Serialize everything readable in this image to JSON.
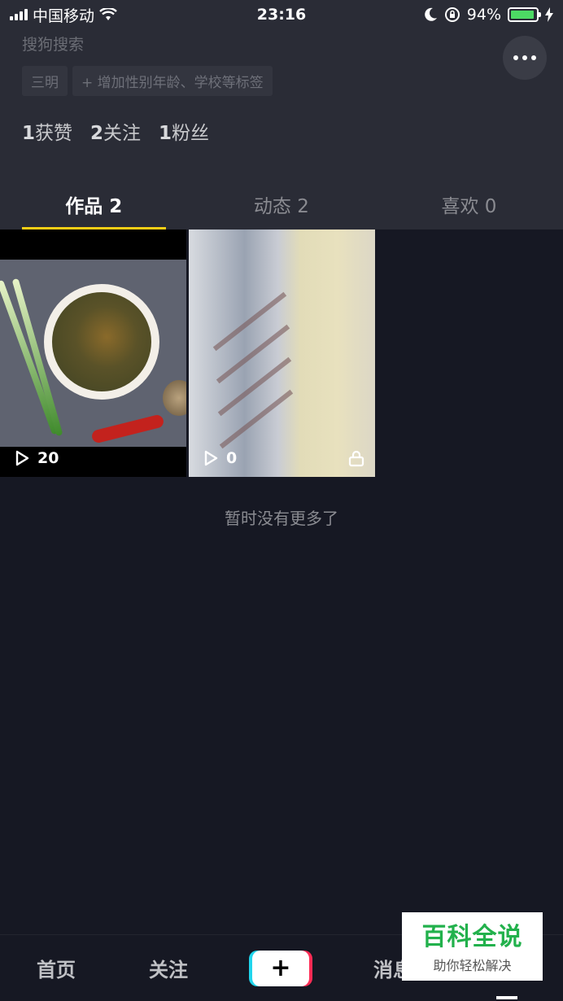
{
  "status_bar": {
    "carrier": "中国移动",
    "time": "23:16",
    "battery": "94%",
    "battery_level": 0.94
  },
  "profile": {
    "search_hint": "搜狗搜索",
    "tags": [
      "三明",
      "+ 增加性别年龄、学校等标签"
    ],
    "stats": [
      {
        "value": "1",
        "label": "获赞"
      },
      {
        "value": "2",
        "label": "关注"
      },
      {
        "value": "1",
        "label": "粉丝"
      }
    ]
  },
  "tabs": [
    {
      "label": "作品 2",
      "active": true
    },
    {
      "label": "动态 2",
      "active": false
    },
    {
      "label": "喜欢 0",
      "active": false
    }
  ],
  "videos": [
    {
      "plays": "20",
      "locked": false,
      "icon": "play-icon"
    },
    {
      "plays": "0",
      "locked": true,
      "icon": "play-icon"
    }
  ],
  "empty_hint": "暂时没有更多了",
  "bottom_nav": {
    "home": "首页",
    "follow": "关注",
    "add": "+",
    "messages": "消息"
  },
  "watermark": {
    "title": "百科全说",
    "subtitle": "助你轻松解决"
  },
  "colors": {
    "background": "#161823",
    "header": "#2a2c36",
    "tab_indicator": "#face15",
    "watermark_green": "#22b14c"
  }
}
